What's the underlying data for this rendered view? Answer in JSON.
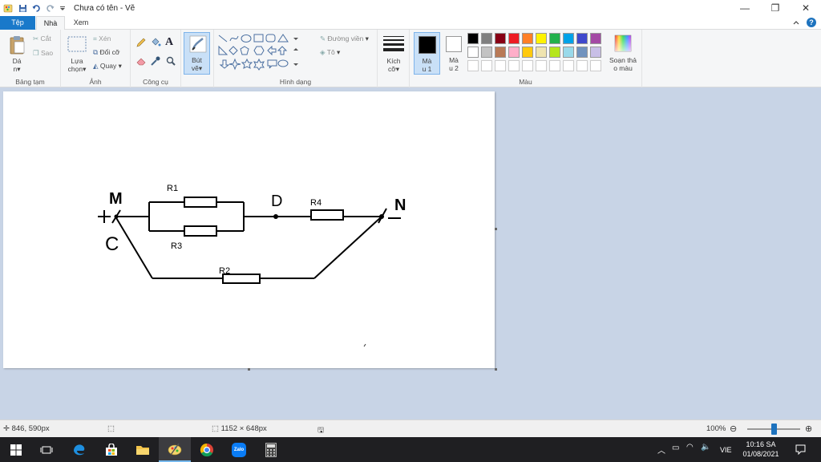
{
  "window": {
    "title": "Chưa có tên - Vẽ",
    "controls": [
      "—",
      "❐",
      "✕"
    ]
  },
  "tabs": {
    "file": "Tệp",
    "home": "Nhà",
    "view": "Xem"
  },
  "ribbon": {
    "clipboard": {
      "paste_line1": "Dá",
      "paste_line2": "n",
      "cut": "Cắt",
      "copy": "Sao",
      "label": "Bảng tạm"
    },
    "image": {
      "select_line1": "Lựa",
      "select_line2": "chọn",
      "crop": "Xén",
      "resize": "Đổi cỡ",
      "rotate": "Quay",
      "label": "Ảnh"
    },
    "tools": {
      "label": "Công cụ"
    },
    "brushes": {
      "line1": "Bút",
      "line2": "vẽ"
    },
    "shapes": {
      "outline": "Đường viền",
      "fill": "Tô",
      "label": "Hình dạng"
    },
    "size": {
      "line1": "Kích",
      "line2": "cỡ"
    },
    "color1": {
      "line1": "Mà",
      "line2": "u 1"
    },
    "color2": {
      "line1": "Mà",
      "line2": "u 2"
    },
    "edit_colors": {
      "line1": "Soạn thả",
      "line2": "o màu"
    },
    "colors_label": "Màu",
    "palette_row1": [
      "#000000",
      "#7f7f7f",
      "#880015",
      "#ed1c24",
      "#ff7f27",
      "#fff200",
      "#22b14c",
      "#00a2e8",
      "#3f48cc",
      "#a349a4"
    ],
    "palette_row2": [
      "#ffffff",
      "#c3c3c3",
      "#b97a57",
      "#ffaec9",
      "#ffc90e",
      "#efe4b0",
      "#b5e61d",
      "#99d9ea",
      "#7092be",
      "#c8bfe7"
    ]
  },
  "canvas": {
    "label_M": "M",
    "label_C": "C",
    "label_D": "D",
    "label_N": "N",
    "label_plus": "+",
    "label_minus": "—",
    "R1": "R1",
    "R2": "R2",
    "R3": "R3",
    "R4": "R4"
  },
  "status": {
    "cursor_pos": "846, 590px",
    "image_size": "1152 × 648px",
    "zoom": "100%",
    "zoom_level": 0.5
  },
  "taskbar": {
    "lang": "VIE",
    "time": "10:16 SA",
    "date": "01/08/2021",
    "zalo": "Zalo"
  },
  "colors": {
    "accent": "#1979ca",
    "taskbar": "#1f1f22",
    "workspace": "#c8d4e6"
  }
}
